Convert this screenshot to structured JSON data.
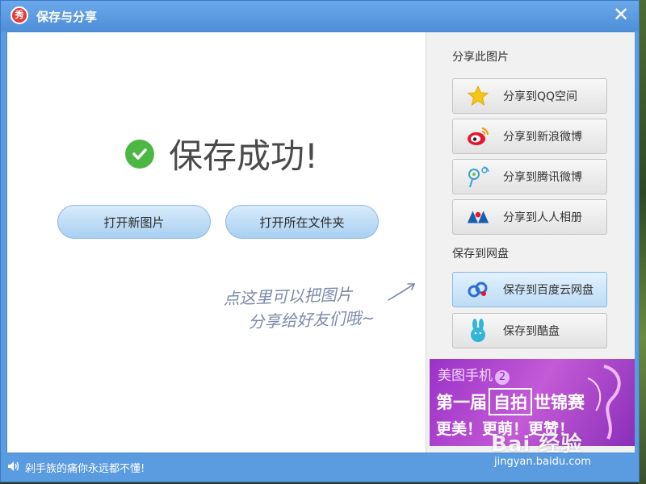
{
  "window": {
    "title": "保存与分享",
    "app_icon_glyph": "秀",
    "close_glyph": "✕"
  },
  "main": {
    "success_text": "保存成功!",
    "buttons": {
      "open_new": "打开新图片",
      "open_folder": "打开所在文件夹"
    },
    "hint_line1": "点这里可以把图片",
    "hint_line2": "分享给好友们哦~"
  },
  "sidebar": {
    "share_heading": "分享此图片",
    "share_items": [
      {
        "label": "分享到QQ空间",
        "icon": "qzone-star-icon"
      },
      {
        "label": "分享到新浪微博",
        "icon": "sina-weibo-icon"
      },
      {
        "label": "分享到腾讯微博",
        "icon": "tencent-weibo-icon"
      },
      {
        "label": "分享到人人相册",
        "icon": "renren-icon"
      }
    ],
    "save_heading": "保存到网盘",
    "save_items": [
      {
        "label": "保存到百度云网盘",
        "icon": "baidu-cloud-icon"
      },
      {
        "label": "保存到酷盘",
        "icon": "kupan-rabbit-icon"
      }
    ],
    "ad": {
      "brand": "美图手机",
      "brand_num": "2",
      "line2_a": "第一届",
      "line2_box": "自拍",
      "line2_b": "世锦赛",
      "line3": "更美！更萌！更赞！"
    }
  },
  "statusbar": {
    "text": "剁手族的痛你永远都不懂!"
  },
  "watermark": {
    "logo": "Bai 经验",
    "url": "jingyan.baidu.com"
  },
  "colors": {
    "window_blue": "#5b9be0",
    "success_green": "#4cb843",
    "ad_purple": "#9a32c8"
  }
}
